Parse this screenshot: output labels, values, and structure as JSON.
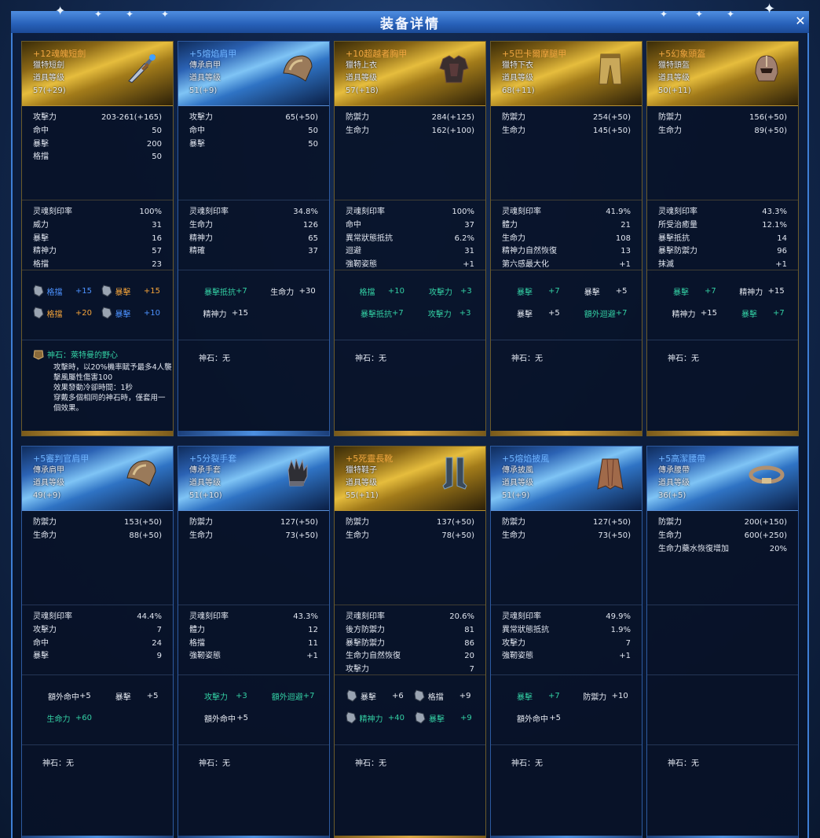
{
  "window": {
    "title": "装备详情",
    "close_icon": "close-icon"
  },
  "cards": [
    {
      "name": "+12魂魄短劍",
      "type": "獵特短劍",
      "level_label": "道具等级",
      "level": "57(+29)",
      "tier": "gold",
      "icon": "dagger-icon",
      "base": [
        [
          "攻擊力",
          "203-261(+165)"
        ],
        [
          "命中",
          "50"
        ],
        [
          "暴擊",
          "200"
        ],
        [
          "格擋",
          "50"
        ]
      ],
      "soul": [
        [
          "灵魂刻印率",
          "100%"
        ],
        [
          "威力",
          "31"
        ],
        [
          "暴擊",
          "16"
        ],
        [
          "精神力",
          "57"
        ],
        [
          "格擋",
          "23"
        ]
      ],
      "engrave": [
        [
          {
            "icon": "stone-icon",
            "name": "格擋",
            "val": "+15",
            "color": "blue"
          },
          {
            "icon": "stone-icon",
            "name": "暴擊",
            "val": "+15",
            "color": "orange"
          }
        ],
        [
          {
            "icon": "stone-icon",
            "name": "格擋",
            "val": "+20",
            "color": "orange"
          },
          {
            "icon": "stone-icon",
            "name": "暴擊",
            "val": "+10",
            "color": "blue"
          }
        ]
      ],
      "stone": {
        "label": "神石：萊特曼的野心",
        "desc": [
          "攻擊時，以20%機率賦予最多4人襲",
          "擊風屬性傷害100",
          "效果發動冷卻時間：1秒",
          "穿戴多個相同的神石時，僅套用一",
          "個效果。"
        ]
      }
    },
    {
      "name": "+5熔焰肩甲",
      "type": "傳承肩甲",
      "level_label": "道具等级",
      "level": "51(+9)",
      "tier": "blue",
      "icon": "pauldron-icon",
      "base": [
        [
          "攻擊力",
          "65(+50)"
        ],
        [
          "命中",
          "50"
        ],
        [
          "暴擊",
          "50"
        ]
      ],
      "soul": [
        [
          "灵魂刻印率",
          "34.8%"
        ],
        [
          "生命力",
          "126"
        ],
        [
          "精神力",
          "65"
        ],
        [
          "精確",
          "37"
        ]
      ],
      "engrave": [
        [
          {
            "name": "暴擊抵抗",
            "val": "+7",
            "color": "green"
          },
          {
            "name": "生命力",
            "val": "+30",
            "color": "white"
          }
        ],
        [
          {
            "name": "精神力",
            "val": "+15",
            "color": "white"
          }
        ]
      ],
      "stone": {
        "label": "神石：无"
      }
    },
    {
      "name": "+10超越者胸甲",
      "type": "獵特上衣",
      "level_label": "道具等级",
      "level": "57(+18)",
      "tier": "gold",
      "icon": "chest-icon",
      "base": [
        [
          "防禦力",
          "284(+125)"
        ],
        [
          "生命力",
          "162(+100)"
        ]
      ],
      "soul": [
        [
          "灵魂刻印率",
          "100%"
        ],
        [
          "命中",
          "37"
        ],
        [
          "異常狀態抵抗",
          "6.2%"
        ],
        [
          "迴避",
          "31"
        ],
        [
          "強靭姿態",
          "+1"
        ]
      ],
      "engrave": [
        [
          {
            "name": "格擋",
            "val": "+10",
            "color": "green"
          },
          {
            "name": "攻擊力",
            "val": "+3",
            "color": "green"
          }
        ],
        [
          {
            "name": "暴擊抵抗",
            "val": "+7",
            "color": "green"
          },
          {
            "name": "攻擊力",
            "val": "+3",
            "color": "green"
          }
        ]
      ],
      "stone": {
        "label": "神石：无"
      }
    },
    {
      "name": "+5巴卡爾摩腿甲",
      "type": "獵特下衣",
      "level_label": "道具等级",
      "level": "68(+11)",
      "tier": "gold",
      "icon": "legs-icon",
      "base": [
        [
          "防禦力",
          "254(+50)"
        ],
        [
          "生命力",
          "145(+50)"
        ]
      ],
      "soul": [
        [
          "灵魂刻印率",
          "41.9%"
        ],
        [
          "體力",
          "21"
        ],
        [
          "生命力",
          "108"
        ],
        [
          "精神力自然恢復",
          "13"
        ],
        [
          "第六感最大化",
          "+1"
        ]
      ],
      "engrave": [
        [
          {
            "name": "暴擊",
            "val": "+7",
            "color": "green"
          },
          {
            "name": "暴擊",
            "val": "+5",
            "color": "white"
          }
        ],
        [
          {
            "name": "暴擊",
            "val": "+5",
            "color": "white"
          },
          {
            "name": "額外迴避",
            "val": "+7",
            "color": "green"
          }
        ]
      ],
      "stone": {
        "label": "神石：无"
      }
    },
    {
      "name": "+5幻象頭盔",
      "type": "獵特頭盔",
      "level_label": "道具等级",
      "level": "50(+11)",
      "tier": "gold",
      "icon": "helmet-icon",
      "base": [
        [
          "防禦力",
          "156(+50)"
        ],
        [
          "生命力",
          "89(+50)"
        ]
      ],
      "soul": [
        [
          "灵魂刻印率",
          "43.3%"
        ],
        [
          "所受治癒量",
          "12.1%"
        ],
        [
          "暴擊抵抗",
          "14"
        ],
        [
          "暴擊防禦力",
          "96"
        ],
        [
          "抹滅",
          "+1"
        ]
      ],
      "engrave": [
        [
          {
            "name": "暴擊",
            "val": "+7",
            "color": "green"
          },
          {
            "name": "精神力",
            "val": "+15",
            "color": "white"
          }
        ],
        [
          {
            "name": "精神力",
            "val": "+15",
            "color": "white"
          },
          {
            "name": "暴擊",
            "val": "+7",
            "color": "green"
          }
        ]
      ],
      "stone": {
        "label": "神石：无"
      }
    },
    {
      "name": "+5審判官肩甲",
      "type": "傳承肩甲",
      "level_label": "道具等级",
      "level": "49(+9)",
      "tier": "blue",
      "icon": "pauldron-icon",
      "base": [
        [
          "防禦力",
          "153(+50)"
        ],
        [
          "生命力",
          "88(+50)"
        ]
      ],
      "soul": [
        [
          "灵魂刻印率",
          "44.4%"
        ],
        [
          "攻擊力",
          "7"
        ],
        [
          "命中",
          "24"
        ],
        [
          "暴擊",
          "9"
        ]
      ],
      "engrave": [
        [
          {
            "name": "額外命中",
            "val": "+5",
            "color": "white"
          },
          {
            "name": "暴擊",
            "val": "+5",
            "color": "white"
          }
        ],
        [
          {
            "name": "生命力",
            "val": "+60",
            "color": "green"
          }
        ]
      ],
      "stone": {
        "label": "神石：无"
      }
    },
    {
      "name": "+5分裂手套",
      "type": "傳承手套",
      "level_label": "道具等级",
      "level": "51(+10)",
      "tier": "blue",
      "icon": "glove-icon",
      "base": [
        [
          "防禦力",
          "127(+50)"
        ],
        [
          "生命力",
          "73(+50)"
        ]
      ],
      "soul": [
        [
          "灵魂刻印率",
          "43.3%"
        ],
        [
          "體力",
          "12"
        ],
        [
          "格擋",
          "11"
        ],
        [
          "強靭姿態",
          "+1"
        ]
      ],
      "engrave": [
        [
          {
            "name": "攻擊力",
            "val": "+3",
            "color": "green"
          },
          {
            "name": "額外迴避",
            "val": "+7",
            "color": "green"
          }
        ],
        [
          {
            "name": "額外命中",
            "val": "+5",
            "color": "white"
          }
        ]
      ],
      "stone": {
        "label": "神石：无"
      }
    },
    {
      "name": "+5死靈長靴",
      "type": "獵特鞋子",
      "level_label": "道具等级",
      "level": "55(+11)",
      "tier": "gold",
      "icon": "boots-icon",
      "base": [
        [
          "防禦力",
          "137(+50)"
        ],
        [
          "生命力",
          "78(+50)"
        ]
      ],
      "soul": [
        [
          "灵魂刻印率",
          "20.6%"
        ],
        [
          "後方防禦力",
          "81"
        ],
        [
          "暴擊防禦力",
          "86"
        ],
        [
          "生命力自然恢復",
          "20"
        ],
        [
          "攻擊力",
          "7"
        ]
      ],
      "engrave": [
        [
          {
            "icon": "stone-icon",
            "name": "暴擊",
            "val": "+6",
            "color": "white"
          },
          {
            "icon": "stone-icon",
            "name": "格擋",
            "val": "+9",
            "color": "white"
          }
        ],
        [
          {
            "icon": "stone-icon",
            "name": "精神力",
            "val": "+40",
            "color": "green"
          },
          {
            "icon": "stone-icon",
            "name": "暴擊",
            "val": "+9",
            "color": "green"
          }
        ]
      ],
      "stone": {
        "label": "神石：无"
      }
    },
    {
      "name": "+5熔焰披風",
      "type": "傳承披風",
      "level_label": "道具等级",
      "level": "51(+9)",
      "tier": "blue",
      "icon": "cape-icon",
      "base": [
        [
          "防禦力",
          "127(+50)"
        ],
        [
          "生命力",
          "73(+50)"
        ]
      ],
      "soul": [
        [
          "灵魂刻印率",
          "49.9%"
        ],
        [
          "異常狀態抵抗",
          "1.9%"
        ],
        [
          "攻擊力",
          "7"
        ],
        [
          "強靭姿態",
          "+1"
        ]
      ],
      "engrave": [
        [
          {
            "name": "暴擊",
            "val": "+7",
            "color": "green"
          },
          {
            "name": "防禦力",
            "val": "+10",
            "color": "white"
          }
        ],
        [
          {
            "name": "額外命中",
            "val": "+5",
            "color": "white"
          }
        ]
      ],
      "stone": {
        "label": "神石：无"
      }
    },
    {
      "name": "+5高潔腰帶",
      "type": "傳承腰帶",
      "level_label": "道具等级",
      "level": "36(+5)",
      "tier": "blue",
      "icon": "belt-icon",
      "base": [
        [
          "防禦力",
          "200(+150)"
        ],
        [
          "生命力",
          "600(+250)"
        ],
        [
          "生命力藥水恢復增加",
          "20%"
        ]
      ],
      "soul": [],
      "engrave": [],
      "stone": {
        "label": "神石：无"
      }
    }
  ]
}
